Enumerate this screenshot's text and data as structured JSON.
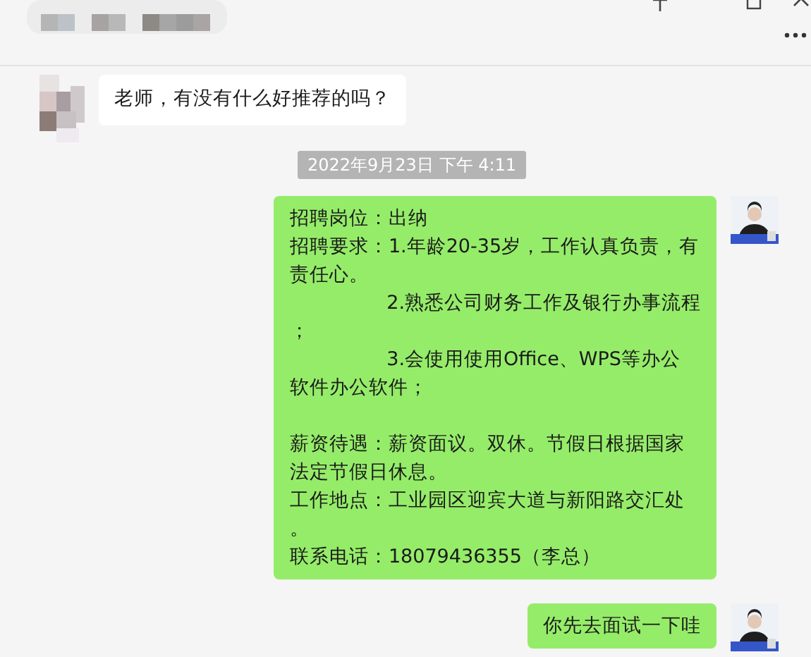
{
  "messages": [
    {
      "kind": "incoming",
      "text": "老师，有没有什么好推荐的吗？"
    },
    {
      "kind": "timestamp",
      "text": "2022年9月23日 下午 4:11"
    },
    {
      "kind": "outgoing",
      "paragraphs": [
        [
          "招聘岗位：出纳",
          "招聘要求：1.年龄20-35岁，工作认真负责，有",
          "责任心。",
          "                2.熟悉公司财务工作及银行办事流程",
          "；",
          "                3.会使用使用Office、WPS等办公",
          "软件办公软件；"
        ],
        [
          "薪资待遇：薪资面议。双休。节假日根据国家",
          "法定节假日休息。",
          "工作地点：工业园区迎宾大道与新阳路交汇处",
          "。",
          "联系电话：18079436355（李总）"
        ]
      ]
    },
    {
      "kind": "outgoing",
      "paragraphs": [
        [
          "你先去面试一下哇"
        ]
      ]
    }
  ]
}
